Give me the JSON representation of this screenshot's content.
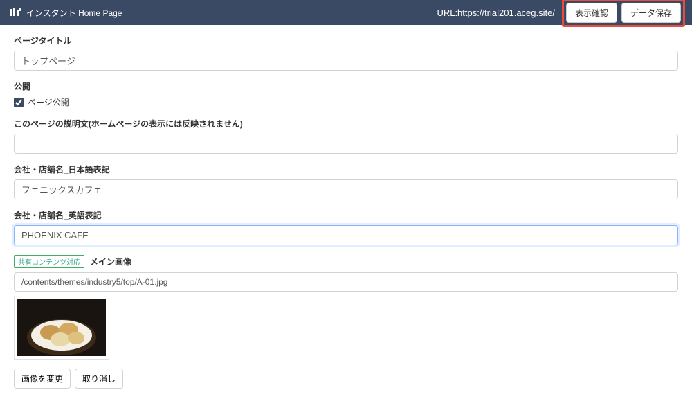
{
  "header": {
    "app_title": "インスタント Home Page",
    "url_label": "URL:https://trial201.aceg.site/",
    "preview_btn": "表示確認",
    "save_btn": "データ保存"
  },
  "fields": {
    "page_title_label": "ページタイトル",
    "page_title_value": "トップページ",
    "publish_label": "公開",
    "publish_checkbox_label": "ページ公開",
    "description_label": "このページの説明文(ホームページの表示には反映されません)",
    "description_value": "",
    "company_jp_label": "会社・店舗名_日本語表記",
    "company_jp_value": "フェニックスカフェ",
    "company_en_label": "会社・店舗名_英語表記",
    "company_en_value": "PHOENIX CAFE",
    "main_image_label": "メイン画像",
    "shared_badge": "共有コンテンツ対応",
    "image_path": "/contents/themes/industry5/top/A-01.jpg",
    "change_image_btn": "画像を変更",
    "cancel_btn": "取り消し"
  }
}
